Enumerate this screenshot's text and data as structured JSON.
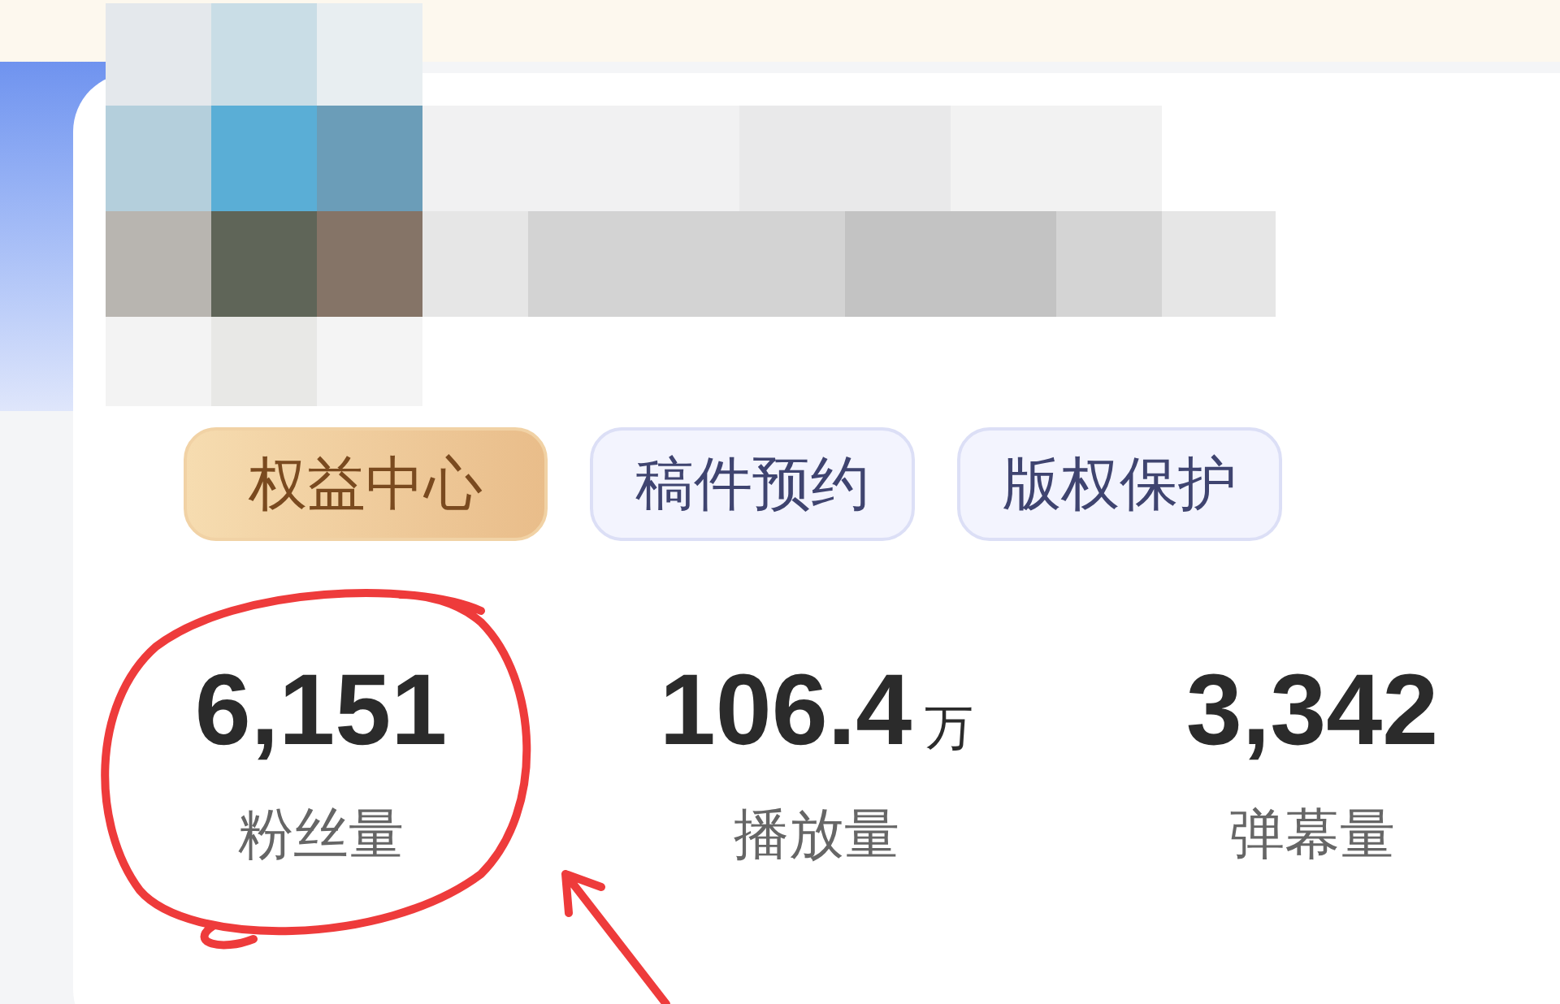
{
  "buttons": [
    {
      "label": "权益中心",
      "kind": "premium"
    },
    {
      "label": "稿件预约",
      "kind": "plain"
    },
    {
      "label": "版权保护",
      "kind": "plain"
    }
  ],
  "stats": [
    {
      "value": "6,151",
      "label": "粉丝量"
    },
    {
      "value": "106.4",
      "unit": "万",
      "label": "播放量"
    },
    {
      "value": "3,342",
      "label": "弹幕量"
    }
  ]
}
